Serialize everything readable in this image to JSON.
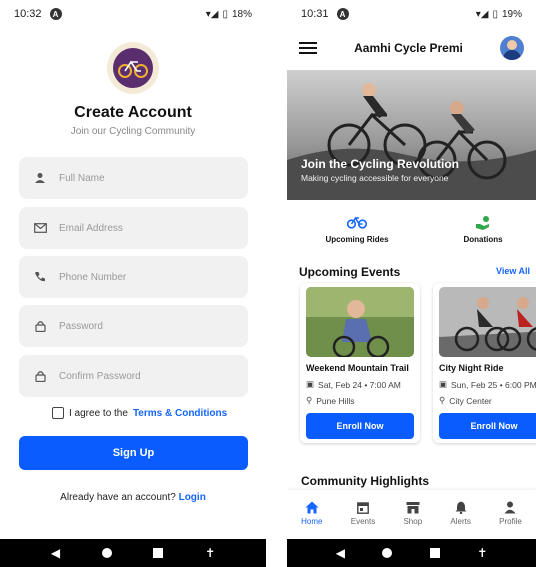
{
  "left": {
    "status": {
      "time": "10:32",
      "circle_letter": "A",
      "battery": "18%"
    },
    "title": "Create Account",
    "subtitle": "Join our Cycling Community",
    "fields": [
      {
        "name": "full-name-field",
        "icon": "person-icon",
        "placeholder": "Full Name"
      },
      {
        "name": "email-field",
        "icon": "envelope-icon",
        "placeholder": "Email Address"
      },
      {
        "name": "phone-field",
        "icon": "phone-icon",
        "placeholder": "Phone Number"
      },
      {
        "name": "password-field",
        "icon": "lock-icon",
        "placeholder": "Password"
      },
      {
        "name": "confirm-password-field",
        "icon": "lock-icon",
        "placeholder": "Confirm Password"
      }
    ],
    "agree_text": "I agree to the",
    "terms_link": "Terms & Conditions",
    "signup_label": "Sign Up",
    "have_account": "Already have an account?",
    "login_link": "Login"
  },
  "right": {
    "status": {
      "time": "10:31",
      "circle_letter": "A",
      "battery": "19%"
    },
    "app_title": "Aamhi Cycle Premi",
    "hero_title": "Join the Cycling Revolution",
    "hero_subtitle": "Making cycling accessible for everyone",
    "quick_actions": [
      {
        "label": "Upcoming Rides",
        "icon": "bicycle-icon"
      },
      {
        "label": "Donations",
        "icon": "donation-icon"
      }
    ],
    "section_title": "Upcoming Events",
    "view_all": "View All",
    "events": [
      {
        "name": "Weekend Mountain Trail",
        "date": "Sat, Feb 24 • 7:00 AM",
        "location": "Pune Hills",
        "enroll": "Enroll Now"
      },
      {
        "name": "City Night Ride",
        "date": "Sun, Feb 25 • 6:00 PM",
        "location": "City Center",
        "enroll": "Enroll Now"
      }
    ],
    "community_title": "Community Highlights",
    "tabs": [
      {
        "label": "Home",
        "icon": "home-icon",
        "active": true
      },
      {
        "label": "Events",
        "icon": "calendar-icon",
        "active": false
      },
      {
        "label": "Shop",
        "icon": "shop-icon",
        "active": false
      },
      {
        "label": "Alerts",
        "icon": "bell-icon",
        "active": false
      },
      {
        "label": "Profile",
        "icon": "profile-icon",
        "active": false
      }
    ]
  },
  "colors": {
    "accent": "#0a5cff",
    "link": "#1565ff",
    "field_bg": "#f1f1f1"
  }
}
